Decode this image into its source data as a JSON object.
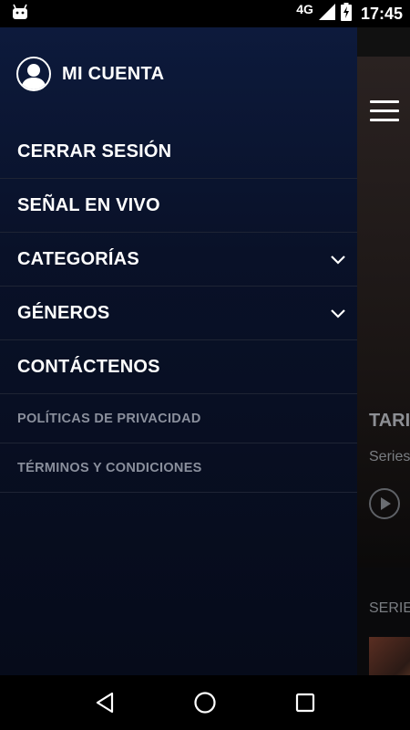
{
  "status_bar": {
    "network": "4G",
    "time": "17:45",
    "icons": [
      "android-icon",
      "signal-icon",
      "battery-charging-icon"
    ]
  },
  "drawer": {
    "account_label": "MI CUENTA",
    "menu": [
      {
        "label": "CERRAR SESIÓN",
        "expandable": false
      },
      {
        "label": "SEÑAL EN VIVO",
        "expandable": false
      },
      {
        "label": "CATEGORÍAS",
        "expandable": true
      },
      {
        "label": "GÉNEROS",
        "expandable": true
      },
      {
        "label": "CONTÁCTENOS",
        "expandable": false
      }
    ],
    "secondary": [
      {
        "label": "POLÍTICAS DE PRIVACIDAD"
      },
      {
        "label": "TÉRMINOS Y CONDICIONES"
      }
    ]
  },
  "background": {
    "title_partial": "TARI",
    "subtitle_partial": "Series",
    "section_partial": "SERIE"
  },
  "nav_bar": {
    "icons": [
      "back-icon",
      "home-icon",
      "recents-icon"
    ]
  },
  "colors": {
    "drawer_top": "#0d1a3c",
    "drawer_bottom": "#060b1a",
    "divider": "#1e2434",
    "secondary_text": "#8a8f9c"
  }
}
